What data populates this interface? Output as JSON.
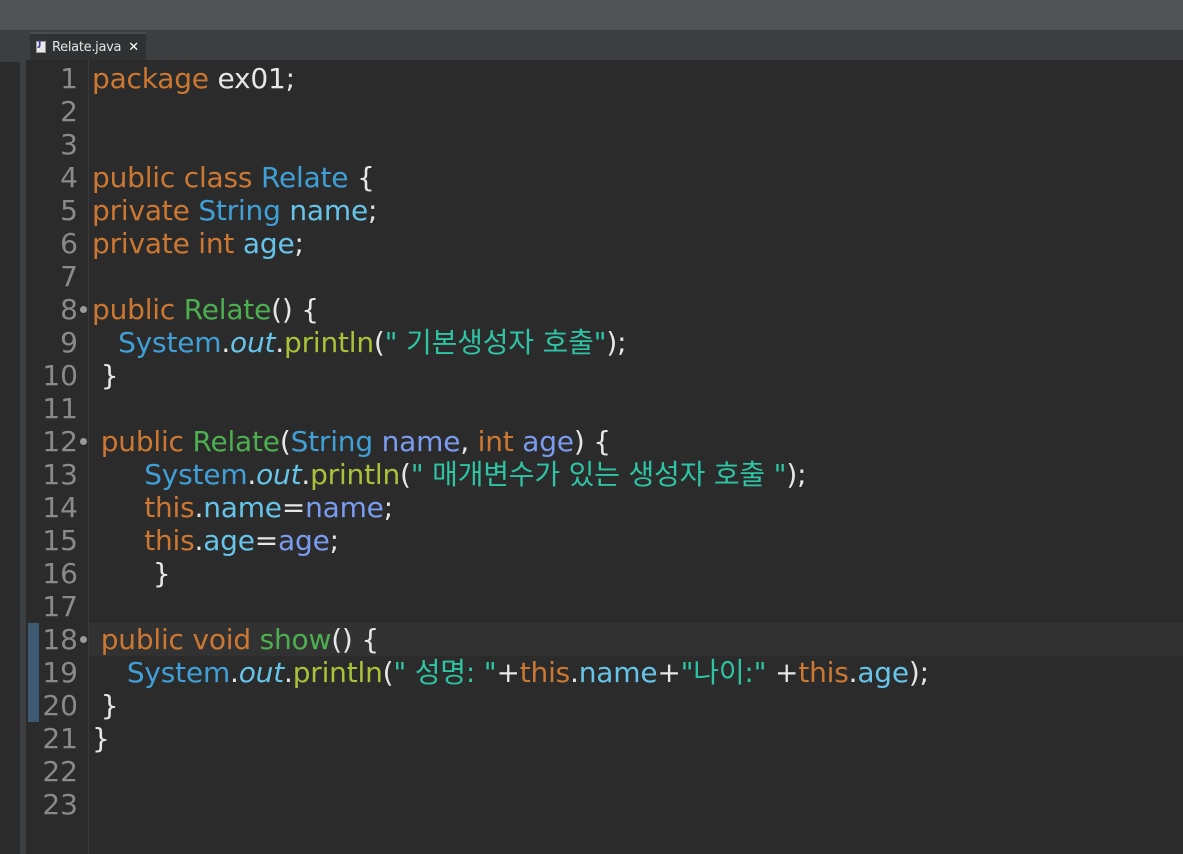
{
  "colors": {
    "keyword": "#cc7832",
    "type": "#3f9fd6",
    "field": "#66c4e8",
    "method_decl": "#4caf50",
    "method_call": "#a8c23a",
    "string": "#2ec4a4",
    "parameter": "#7a9cf0",
    "text": "#e6e6e6",
    "line_number": "#8a8a8a",
    "background": "#2b2b2b"
  },
  "editor": {
    "tab": {
      "label": "Relate.java",
      "close": "✕",
      "icon": "java-file-icon"
    }
  },
  "gutter": {
    "line_numbers": [
      "1",
      "2",
      "3",
      "4",
      "5",
      "6",
      "7",
      "8",
      "9",
      "10",
      "11",
      "12",
      "13",
      "14",
      "15",
      "16",
      "17",
      "18",
      "19",
      "20",
      "21",
      "22",
      "23"
    ],
    "fold_markers": [
      "8",
      "12",
      "18"
    ],
    "current_line": "18"
  },
  "code": {
    "lines": [
      {
        "n": "1",
        "tokens": [
          {
            "t": "package",
            "c": "kw"
          },
          {
            "t": " ex01;",
            "c": "plain"
          }
        ]
      },
      {
        "n": "2",
        "tokens": []
      },
      {
        "n": "3",
        "tokens": []
      },
      {
        "n": "4",
        "tokens": [
          {
            "t": "public class ",
            "c": "kw"
          },
          {
            "t": "Relate",
            "c": "type"
          },
          {
            "t": " {",
            "c": "plain"
          }
        ]
      },
      {
        "n": "5",
        "tokens": [
          {
            "t": "private ",
            "c": "kw"
          },
          {
            "t": "String",
            "c": "type"
          },
          {
            "t": " ",
            "c": "plain"
          },
          {
            "t": "name",
            "c": "fld"
          },
          {
            "t": ";",
            "c": "plain"
          }
        ]
      },
      {
        "n": "6",
        "tokens": [
          {
            "t": "private int ",
            "c": "kw"
          },
          {
            "t": "age",
            "c": "fld"
          },
          {
            "t": ";",
            "c": "plain"
          }
        ]
      },
      {
        "n": "7",
        "tokens": []
      },
      {
        "n": "8",
        "tokens": [
          {
            "t": "public ",
            "c": "kw"
          },
          {
            "t": "Relate",
            "c": "meth"
          },
          {
            "t": "() {",
            "c": "plain"
          }
        ]
      },
      {
        "n": "9",
        "tokens": [
          {
            "t": "   ",
            "c": "plain"
          },
          {
            "t": "System",
            "c": "type"
          },
          {
            "t": ".",
            "c": "plain"
          },
          {
            "t": "out",
            "c": "outf"
          },
          {
            "t": ".",
            "c": "plain"
          },
          {
            "t": "println",
            "c": "call"
          },
          {
            "t": "(",
            "c": "plain"
          },
          {
            "t": "\" 기본생성자 호출\"",
            "c": "str"
          },
          {
            "t": ");",
            "c": "plain"
          }
        ]
      },
      {
        "n": "10",
        "tokens": [
          {
            "t": " }",
            "c": "plain"
          }
        ]
      },
      {
        "n": "11",
        "tokens": []
      },
      {
        "n": "12",
        "tokens": [
          {
            "t": " public ",
            "c": "kw"
          },
          {
            "t": "Relate",
            "c": "meth"
          },
          {
            "t": "(",
            "c": "plain"
          },
          {
            "t": "String",
            "c": "type"
          },
          {
            "t": " ",
            "c": "plain"
          },
          {
            "t": "name",
            "c": "prm"
          },
          {
            "t": ", ",
            "c": "plain"
          },
          {
            "t": "int ",
            "c": "kw"
          },
          {
            "t": "age",
            "c": "prm"
          },
          {
            "t": ") {",
            "c": "plain"
          }
        ]
      },
      {
        "n": "13",
        "tokens": [
          {
            "t": "      ",
            "c": "plain"
          },
          {
            "t": "System",
            "c": "type"
          },
          {
            "t": ".",
            "c": "plain"
          },
          {
            "t": "out",
            "c": "outf"
          },
          {
            "t": ".",
            "c": "plain"
          },
          {
            "t": "println",
            "c": "call"
          },
          {
            "t": "(",
            "c": "plain"
          },
          {
            "t": "\" 매개변수가 있는 생성자 호출 \"",
            "c": "str"
          },
          {
            "t": ");",
            "c": "plain"
          }
        ]
      },
      {
        "n": "14",
        "tokens": [
          {
            "t": "      ",
            "c": "plain"
          },
          {
            "t": "this",
            "c": "kw"
          },
          {
            "t": ".",
            "c": "plain"
          },
          {
            "t": "name",
            "c": "fld"
          },
          {
            "t": "=",
            "c": "plain"
          },
          {
            "t": "name",
            "c": "prm"
          },
          {
            "t": ";",
            "c": "plain"
          }
        ]
      },
      {
        "n": "15",
        "tokens": [
          {
            "t": "      ",
            "c": "plain"
          },
          {
            "t": "this",
            "c": "kw"
          },
          {
            "t": ".",
            "c": "plain"
          },
          {
            "t": "age",
            "c": "fld"
          },
          {
            "t": "=",
            "c": "plain"
          },
          {
            "t": "age",
            "c": "prm"
          },
          {
            "t": ";",
            "c": "plain"
          }
        ]
      },
      {
        "n": "16",
        "tokens": [
          {
            "t": "       }",
            "c": "plain"
          }
        ]
      },
      {
        "n": "17",
        "tokens": []
      },
      {
        "n": "18",
        "tokens": [
          {
            "t": " public void ",
            "c": "kw"
          },
          {
            "t": "show",
            "c": "meth"
          },
          {
            "t": "() {",
            "c": "plain"
          }
        ]
      },
      {
        "n": "19",
        "tokens": [
          {
            "t": "    ",
            "c": "plain"
          },
          {
            "t": "System",
            "c": "type"
          },
          {
            "t": ".",
            "c": "plain"
          },
          {
            "t": "out",
            "c": "outf"
          },
          {
            "t": ".",
            "c": "plain"
          },
          {
            "t": "println",
            "c": "call"
          },
          {
            "t": "(",
            "c": "plain"
          },
          {
            "t": "\" 성명: \"",
            "c": "str"
          },
          {
            "t": "+",
            "c": "plain"
          },
          {
            "t": "this",
            "c": "kw"
          },
          {
            "t": ".",
            "c": "plain"
          },
          {
            "t": "name",
            "c": "fld"
          },
          {
            "t": "+",
            "c": "plain"
          },
          {
            "t": "\"나이:\"",
            "c": "str"
          },
          {
            "t": " +",
            "c": "plain"
          },
          {
            "t": "this",
            "c": "kw"
          },
          {
            "t": ".",
            "c": "plain"
          },
          {
            "t": "age",
            "c": "fld"
          },
          {
            "t": ");",
            "c": "plain"
          }
        ]
      },
      {
        "n": "20",
        "tokens": [
          {
            "t": " }",
            "c": "plain"
          }
        ]
      },
      {
        "n": "21",
        "tokens": [
          {
            "t": "}",
            "c": "plain"
          }
        ]
      },
      {
        "n": "22",
        "tokens": []
      },
      {
        "n": "23",
        "tokens": []
      }
    ]
  }
}
